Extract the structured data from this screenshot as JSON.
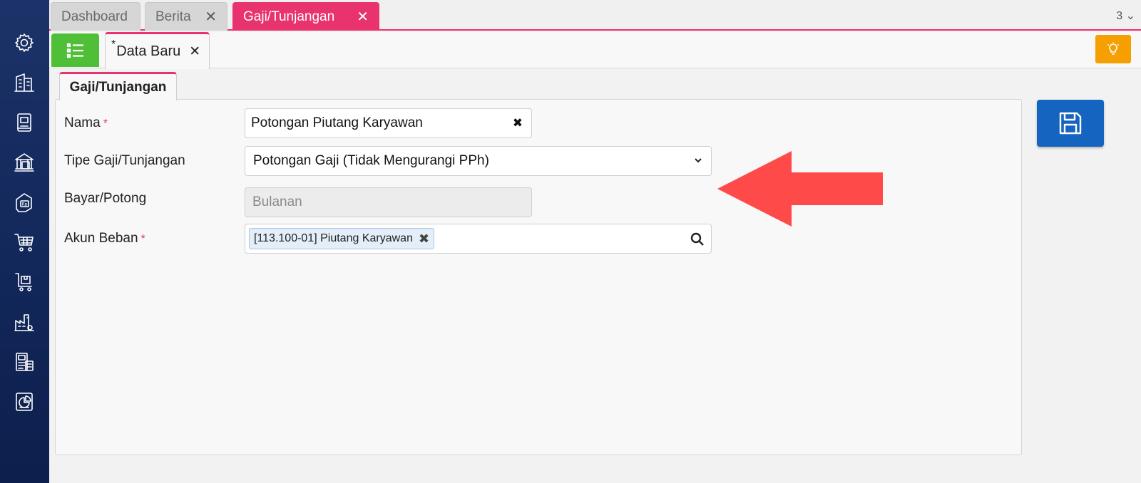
{
  "top_tabs": [
    {
      "label": "Dashboard",
      "active": false,
      "closable": false
    },
    {
      "label": "Berita",
      "active": false,
      "closable": true
    },
    {
      "label": "Gaji/Tunjangan",
      "active": true,
      "closable": true
    }
  ],
  "tab_count": "3",
  "sub_tab": {
    "modified_marker": "*",
    "label": "Data Baru"
  },
  "form_tab": {
    "label": "Gaji/Tunjangan"
  },
  "form": {
    "nama": {
      "label": "Nama",
      "required_mark": "*",
      "value": "Potongan Piutang Karyawan"
    },
    "tipe": {
      "label": "Tipe Gaji/Tunjangan",
      "value": "Potongan Gaji (Tidak Mengurangi PPh)"
    },
    "bayar": {
      "label": "Bayar/Potong",
      "value": "Bulanan"
    },
    "akun": {
      "label": "Akun Beban",
      "required_mark": "*",
      "chip": "[113.100-01] Piutang Karyawan"
    }
  },
  "icons": {
    "sidebar": [
      "gear-icon",
      "building-icon",
      "book-icon",
      "bank-icon",
      "rupiah-tag-icon",
      "cart-icon",
      "trolley-icon",
      "factory-icon",
      "tax-report-icon",
      "pie-chart-icon"
    ],
    "close": "x-icon",
    "list": "list-icon",
    "hint": "lightbulb-icon",
    "save": "floppy-disk-icon",
    "search": "search-icon",
    "dropdown": "chevron-down-icon"
  },
  "colors": {
    "accent": "#e8336e",
    "sidebar": "#12275a",
    "list_button": "#4fbf37",
    "hint_button": "#f5a000",
    "save_button": "#1565c0",
    "annotation_arrow": "#ff4a4a"
  }
}
